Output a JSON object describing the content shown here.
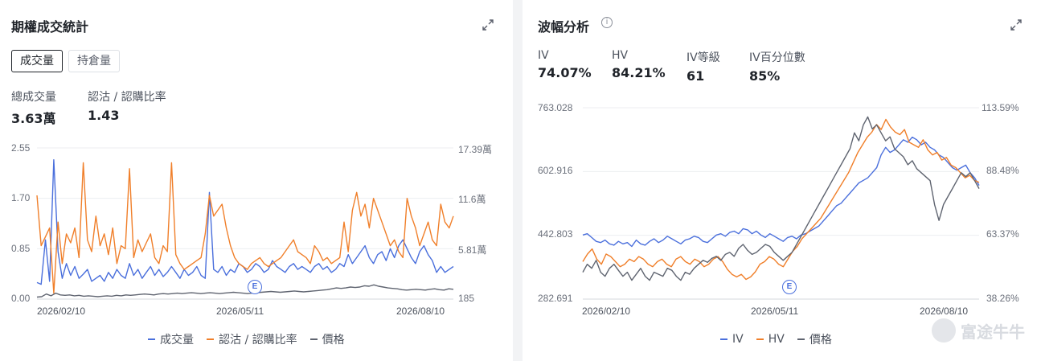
{
  "volume_panel": {
    "title": "期權成交統計",
    "tabs": [
      "成交量",
      "持倉量"
    ],
    "stats": [
      {
        "label": "總成交量",
        "value": "3.63萬"
      },
      {
        "label": "認沽 / 認購比率",
        "value": "1.43"
      }
    ],
    "left_ticks": [
      "2.55",
      "1.70",
      "0.85",
      "0.00"
    ],
    "right_ticks": [
      "17.39萬",
      "11.6萬",
      "5.81萬",
      "185"
    ],
    "x_labels": [
      "2026/02/10",
      "2026/05/11",
      "2026/08/10"
    ],
    "event_marker": "E",
    "legend": [
      "成交量",
      "認沽 / 認購比率",
      "價格"
    ]
  },
  "volatility_panel": {
    "title": "波幅分析",
    "info_icon": "i",
    "stats": [
      {
        "label": "IV",
        "value": "74.07%"
      },
      {
        "label": "HV",
        "value": "84.21%"
      },
      {
        "label": "IV等級",
        "value": "61"
      },
      {
        "label": "IV百分位數",
        "value": "85%"
      }
    ],
    "left_ticks": [
      "763.028",
      "602.916",
      "442.803",
      "282.691"
    ],
    "right_ticks": [
      "113.59%",
      "88.48%",
      "63.37%",
      "38.26%"
    ],
    "x_labels": [
      "2026/02/10",
      "2026/05/11",
      "2026/08/10"
    ],
    "event_marker": "E",
    "legend": [
      "IV",
      "HV",
      "價格"
    ]
  },
  "watermark": "富途牛牛",
  "colors": {
    "blue": "#4a6fdc",
    "orange": "#f07f2a",
    "gray": "#5f6470"
  },
  "chart_data": [
    {
      "type": "line",
      "title": "期權成交統計",
      "x_range": [
        "2026/01/29",
        "2026/08/10"
      ],
      "ylim_left": [
        0,
        2.55
      ],
      "ylim_right": [
        185,
        173900
      ],
      "series": [
        {
          "name": "成交量",
          "axis": "left",
          "values": [
            0.28,
            0.25,
            1.0,
            0.3,
            2.35,
            0.8,
            0.35,
            0.6,
            0.4,
            0.55,
            0.35,
            0.42,
            0.5,
            0.3,
            0.35,
            0.4,
            0.3,
            0.45,
            0.35,
            0.5,
            0.4,
            0.35,
            0.6,
            0.4,
            0.5,
            0.35,
            0.45,
            0.55,
            0.4,
            0.5,
            0.38,
            0.45,
            0.55,
            0.45,
            0.35,
            0.5,
            0.4,
            0.45,
            0.55,
            0.4,
            0.35,
            1.8,
            0.5,
            0.45,
            0.55,
            0.4,
            0.5,
            0.45,
            0.6,
            0.55,
            0.45,
            0.5,
            0.6,
            0.55,
            0.45,
            0.5,
            0.65,
            0.55,
            0.5,
            0.45,
            0.55,
            0.6,
            0.5,
            0.55,
            0.5,
            0.45,
            0.55,
            0.6,
            0.5,
            0.55,
            0.45,
            0.5,
            0.6,
            0.55,
            0.75,
            0.6,
            0.7,
            0.8,
            0.9,
            0.7,
            0.6,
            0.75,
            0.8,
            0.65,
            0.85,
            0.7,
            0.9,
            1.0,
            0.85,
            0.7,
            0.6,
            0.8,
            0.9,
            0.75,
            0.65,
            0.45,
            0.55,
            0.45,
            0.5,
            0.55
          ]
        },
        {
          "name": "認沽 / 認購比率",
          "axis": "left",
          "values": [
            1.75,
            0.9,
            1.05,
            1.2,
            0.1,
            1.3,
            0.6,
            1.1,
            0.95,
            1.2,
            0.7,
            2.3,
            1.0,
            0.8,
            1.4,
            0.9,
            1.1,
            0.75,
            1.2,
            0.6,
            0.9,
            0.85,
            2.2,
            0.7,
            1.0,
            0.8,
            0.95,
            1.1,
            0.7,
            0.6,
            0.9,
            0.8,
            2.3,
            0.75,
            0.6,
            0.5,
            0.55,
            0.6,
            0.65,
            0.7,
            1.1,
            1.75,
            1.4,
            1.5,
            1.6,
            1.2,
            0.9,
            0.7,
            0.6,
            0.55,
            0.5,
            0.6,
            0.65,
            0.7,
            0.6,
            0.55,
            0.6,
            0.65,
            0.7,
            0.8,
            0.9,
            1.0,
            0.8,
            0.75,
            0.7,
            0.6,
            0.9,
            0.8,
            0.65,
            0.7,
            0.6,
            0.65,
            0.7,
            1.3,
            0.8,
            1.5,
            1.8,
            1.4,
            1.6,
            1.2,
            1.7,
            1.5,
            1.3,
            1.1,
            0.9,
            1.0,
            0.8,
            0.7,
            1.7,
            1.4,
            1.2,
            0.9,
            1.1,
            1.3,
            1.0,
            0.9,
            1.6,
            1.3,
            1.2,
            1.4
          ]
        },
        {
          "name": "價格",
          "axis": "right",
          "values": [
            2500,
            3000,
            6000,
            4000,
            7000,
            5000,
            4500,
            5000,
            4000,
            4500,
            3500,
            4000,
            3500,
            3000,
            3500,
            4000,
            3500,
            4500,
            4000,
            5000,
            4500,
            5000,
            5500,
            6000,
            5500,
            5000,
            6000,
            6500,
            6000,
            6500,
            7000,
            6500,
            7000,
            7500,
            7000,
            6500,
            7000,
            7500,
            7000,
            6500,
            7000,
            7500,
            8000,
            7500,
            7000,
            6500,
            7000,
            7500,
            8000,
            8500,
            9000,
            8500,
            8000,
            8500,
            9000,
            9500,
            9000,
            8500,
            9000,
            9500,
            10000,
            10500,
            11000,
            12000,
            13000,
            12500,
            13000,
            14000,
            13500,
            14000,
            15500,
            15000,
            16500,
            15000,
            14000,
            13000,
            12500,
            12000,
            11000,
            10500,
            11000,
            11500,
            11000,
            10500,
            11500,
            12000,
            11000,
            10500,
            12000,
            11500
          ]
        }
      ]
    },
    {
      "type": "line",
      "title": "波幅分析",
      "x_range": [
        "2026/01/29",
        "2026/08/10"
      ],
      "ylim_left": [
        282.691,
        763.028
      ],
      "ylim_right": [
        38.26,
        113.59
      ],
      "series": [
        {
          "name": "IV",
          "axis": "right",
          "values": [
            63.5,
            64.0,
            62.5,
            61.0,
            60.5,
            61.5,
            60.0,
            59.5,
            61.0,
            60.0,
            60.5,
            59.0,
            61.5,
            60.0,
            59.5,
            61.0,
            62.0,
            60.5,
            61.5,
            63.0,
            62.0,
            61.0,
            60.0,
            61.5,
            62.0,
            63.0,
            62.5,
            61.0,
            60.5,
            62.0,
            63.5,
            64.0,
            63.0,
            64.5,
            65.0,
            64.0,
            66.0,
            65.5,
            64.0,
            65.0,
            63.5,
            62.5,
            64.0,
            63.0,
            62.0,
            61.0,
            62.5,
            63.0,
            62.0,
            63.5,
            64.0,
            65.0,
            66.0,
            67.0,
            69.0,
            71.0,
            73.0,
            75.0,
            76.0,
            78.0,
            80.0,
            82.0,
            84.0,
            85.0,
            86.0,
            88.0,
            90.0,
            95.0,
            98.0,
            96.0,
            97.0,
            99.0,
            101.0,
            100.0,
            102.0,
            101.0,
            99.0,
            100.0,
            98.0,
            97.0,
            95.0,
            94.0,
            92.0,
            90.0,
            89.0,
            90.0,
            91.0,
            88.0,
            86.0,
            83.0
          ]
        },
        {
          "name": "HV",
          "axis": "right",
          "values": [
            53.0,
            56.0,
            58.0,
            54.0,
            52.0,
            56.0,
            55.0,
            53.0,
            51.0,
            52.0,
            54.0,
            53.0,
            55.0,
            54.0,
            52.0,
            51.0,
            53.0,
            54.0,
            52.0,
            51.0,
            54.0,
            55.0,
            53.0,
            52.0,
            54.0,
            53.0,
            51.0,
            52.0,
            54.0,
            55.0,
            53.0,
            50.0,
            48.0,
            47.0,
            48.0,
            46.0,
            47.0,
            49.0,
            52.0,
            53.0,
            55.0,
            54.0,
            52.0,
            51.0,
            54.0,
            57.0,
            59.0,
            62.0,
            64.0,
            66.0,
            68.0,
            70.0,
            73.0,
            76.0,
            79.0,
            82.0,
            85.0,
            88.0,
            92.0,
            96.0,
            99.0,
            102.0,
            104.0,
            107.0,
            105.0,
            109.0,
            106.0,
            104.0,
            103.0,
            105.0,
            100.0,
            99.0,
            98.0,
            101.0,
            97.0,
            95.0,
            96.0,
            93.0,
            94.0,
            91.0,
            90.0,
            88.0,
            86.0,
            87.0,
            85.0,
            84.2
          ]
        },
        {
          "name": "價格",
          "axis": "left",
          "values": [
            350,
            370,
            360,
            380,
            350,
            340,
            360,
            370,
            355,
            340,
            350,
            330,
            345,
            360,
            340,
            330,
            350,
            345,
            340,
            360,
            355,
            340,
            330,
            350,
            345,
            360,
            370,
            380,
            375,
            385,
            390,
            380,
            395,
            400,
            390,
            410,
            420,
            405,
            395,
            400,
            410,
            420,
            415,
            400,
            390,
            380,
            390,
            400,
            420,
            440,
            460,
            480,
            500,
            520,
            540,
            560,
            580,
            600,
            620,
            640,
            660,
            700,
            680,
            720,
            740,
            710,
            720,
            700,
            680,
            690,
            660,
            650,
            640,
            620,
            630,
            610,
            600,
            590,
            580,
            520,
            480,
            520,
            540,
            560,
            580,
            600,
            590,
            600,
            580,
            560
          ]
        }
      ]
    }
  ]
}
